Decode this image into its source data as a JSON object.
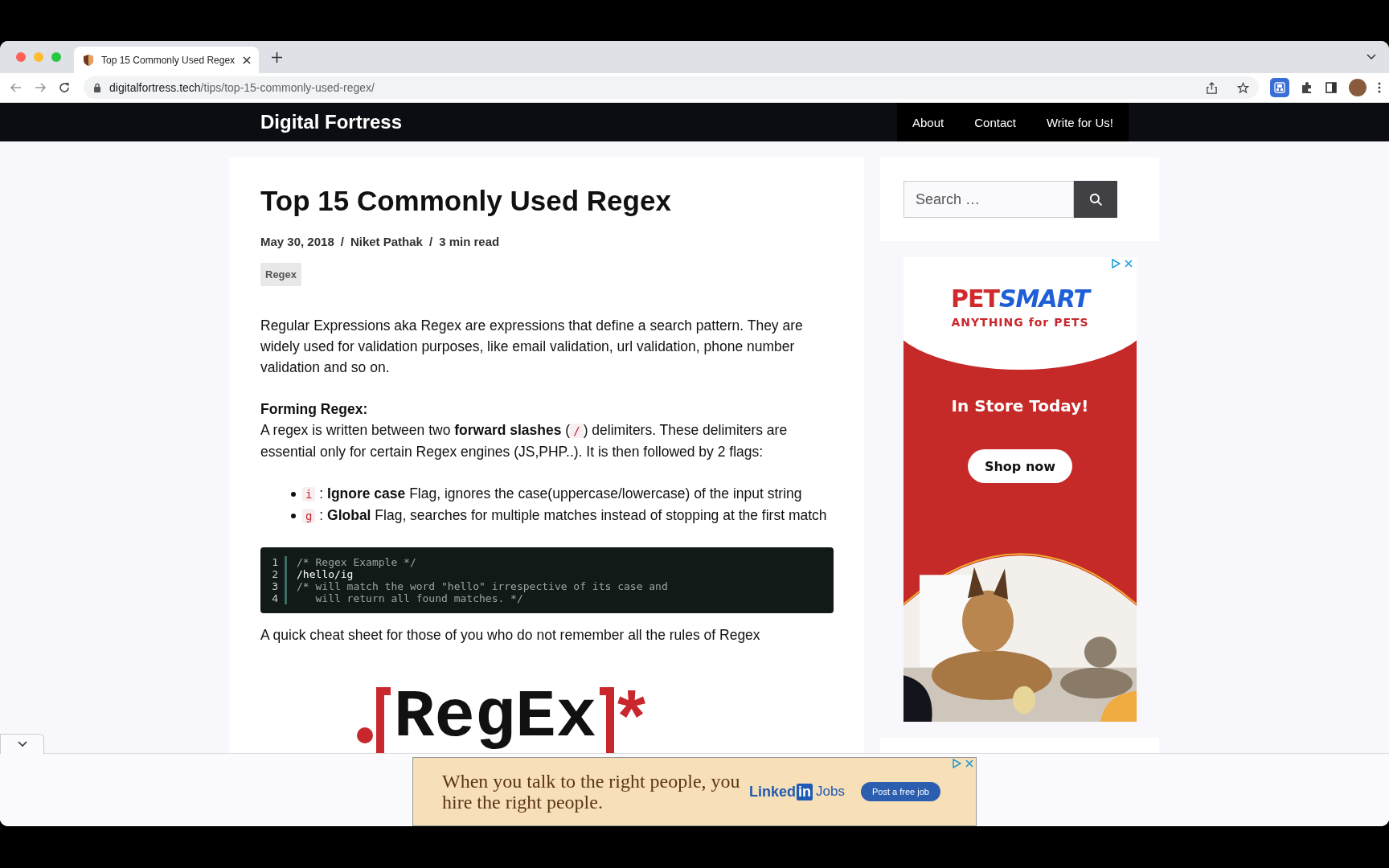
{
  "browser": {
    "tab_title": "Top 15 Commonly Used Regex",
    "url_domain": "digitalfortress.tech",
    "url_path": "/tips/top-15-commonly-used-regex/"
  },
  "site": {
    "title": "Digital Fortress",
    "nav": [
      {
        "label": "About"
      },
      {
        "label": "Contact"
      },
      {
        "label": "Write for Us!"
      }
    ]
  },
  "article": {
    "title": "Top 15 Commonly Used Regex",
    "meta": [
      "May 30, 2018",
      "Niket Pathak",
      "3 min read"
    ],
    "meta_separator": "/",
    "tag": "Regex",
    "blocks": [
      {
        "kind": "paragraph",
        "segments": [
          {
            "text": "Regular Expressions aka Regex are expressions that define a search pattern. They are widely used for validation purposes, like email validation, url validation, phone number validation and so on."
          }
        ]
      },
      {
        "kind": "paragraph",
        "heading": "Forming Regex:",
        "segments": [
          {
            "text": "A regex is written between two **forward slashes** ("
          },
          {
            "code": "/"
          },
          {
            "text": ") delimiters. These delimiters are essential only for certain Regex engines (JS,PHP..). It is then followed by 2 flags:"
          }
        ]
      },
      {
        "kind": "list",
        "items": [
          [
            {
              "code": "i"
            },
            {
              "text": " : **Ignore case** Flag, ignores the case(uppercase/lowercase) of the input string"
            }
          ],
          [
            {
              "code": "g"
            },
            {
              "text": " : **Global** Flag, searches for multiple matches instead of stopping at the first match"
            }
          ]
        ]
      },
      {
        "kind": "code",
        "lines": [
          {
            "number": "1",
            "kind": "comment",
            "text": "/* Regex Example */"
          },
          {
            "number": "2",
            "kind": "code",
            "text": "/hello/ig"
          },
          {
            "number": "3",
            "kind": "comment",
            "text": "/* will match the word \"hello\" irrespective of its case and"
          },
          {
            "number": "4",
            "kind": "comment",
            "text": "   will return all found matches. */"
          }
        ]
      },
      {
        "kind": "paragraph",
        "segments": [
          {
            "text": "A quick cheat sheet for those of you who do not remember all the rules of Regex"
          }
        ]
      },
      {
        "kind": "logo",
        "word": "RegEx",
        "mark": "*"
      }
    ]
  },
  "sidebar": {
    "search": {
      "placeholder": "Search …"
    },
    "ad": {
      "brand_left": "PET",
      "brand_right": "SMART",
      "slogan": "ANYTHING for PETS",
      "headline": "In Store Today!",
      "button": "Shop now"
    }
  },
  "bottom_ad": {
    "text": "When you talk to the right people, you hire the right people.",
    "brand_left": "Linked",
    "brand_right": "in",
    "brand_suffix": "Jobs",
    "button": "Post a free job"
  }
}
